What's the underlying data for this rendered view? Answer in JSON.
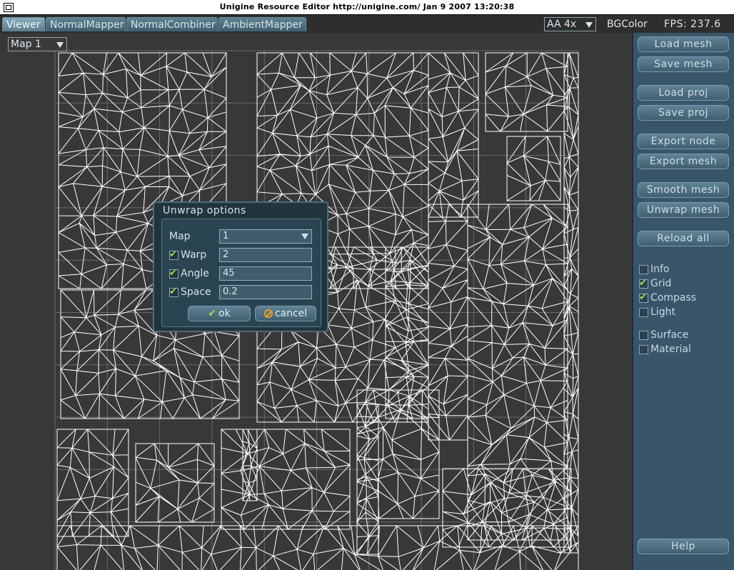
{
  "window": {
    "title": "Unigine Resource Editor http://unigine.com/  Jan  9 2007 13:20:38"
  },
  "tabs": [
    {
      "label": "Viewer",
      "active": true
    },
    {
      "label": "NormalMapper",
      "active": false
    },
    {
      "label": "NormalCombiner",
      "active": false
    },
    {
      "label": "AmbientMapper",
      "active": false
    }
  ],
  "header": {
    "aa_value": "AA 4x",
    "bgcolor_label": "BGColor",
    "fps_text": "FPS: 237.6"
  },
  "viewport": {
    "map_select_value": "Map 1"
  },
  "panel": {
    "buttons": {
      "load_mesh": "Load mesh",
      "save_mesh": "Save mesh",
      "load_proj": "Load proj",
      "save_proj": "Save proj",
      "export_node": "Export node",
      "export_mesh": "Export mesh",
      "smooth_mesh": "Smooth mesh",
      "unwrap_mesh": "Unwrap mesh",
      "reload_all": "Reload all",
      "help": "Help"
    },
    "checks": [
      {
        "label": "Info",
        "checked": false
      },
      {
        "label": "Grid",
        "checked": true
      },
      {
        "label": "Compass",
        "checked": true
      },
      {
        "label": "Light",
        "checked": false
      },
      {
        "label": "Surface",
        "checked": false
      },
      {
        "label": "Material",
        "checked": false
      }
    ]
  },
  "dialog": {
    "title": "Unwrap options",
    "map_label": "Map",
    "map_value": "1",
    "warp_label": "Warp",
    "warp_value": "2",
    "warp_checked": true,
    "angle_label": "Angle",
    "angle_value": "45",
    "angle_checked": true,
    "space_label": "Space",
    "space_value": "0.2",
    "space_checked": true,
    "ok_label": "ok",
    "cancel_label": "cancel"
  },
  "colors": {
    "panel_bg": "#38556a",
    "viewport_bg": "#383838",
    "wireframe": "#ffffff",
    "grid": "#6a6a6a",
    "check_accent": "#9be04a"
  }
}
